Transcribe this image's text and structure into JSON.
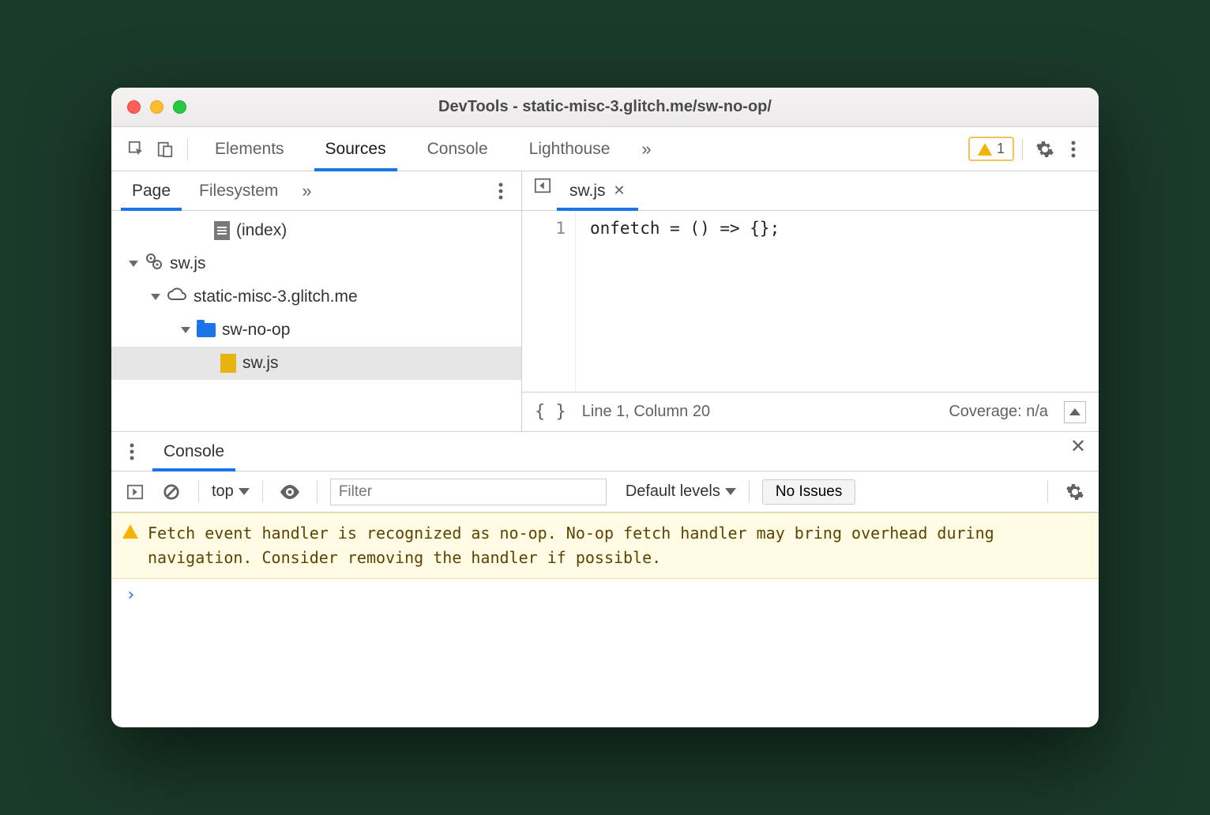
{
  "window": {
    "title": "DevTools - static-misc-3.glitch.me/sw-no-op/"
  },
  "toolbar": {
    "tabs": {
      "elements": "Elements",
      "sources": "Sources",
      "console": "Console",
      "lighthouse": "Lighthouse"
    },
    "warning_count": "1"
  },
  "sources": {
    "subtabs": {
      "page": "Page",
      "filesystem": "Filesystem"
    },
    "tree": {
      "index_label": "(index)",
      "sw_worker": "sw.js",
      "domain": "static-misc-3.glitch.me",
      "folder": "sw-no-op",
      "file": "sw.js"
    },
    "editor": {
      "tab": "sw.js",
      "line_number": "1",
      "code": "onfetch = () => {};"
    },
    "status": {
      "position": "Line 1, Column 20",
      "coverage": "Coverage: n/a"
    }
  },
  "drawer": {
    "tab": "Console",
    "context": "top",
    "filter_placeholder": "Filter",
    "levels": "Default levels",
    "issues": "No Issues",
    "warning_message": "Fetch event handler is recognized as no-op. No-op fetch handler may bring overhead during navigation. Consider removing the handler if possible.",
    "prompt": "›"
  }
}
